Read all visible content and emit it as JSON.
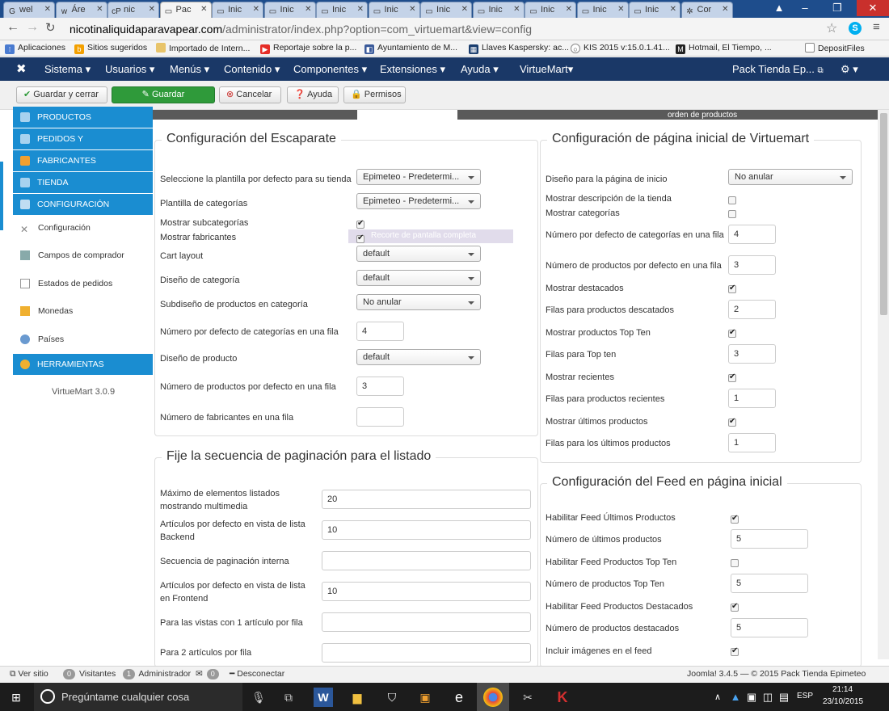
{
  "browser": {
    "tabs": [
      {
        "title": "wel",
        "icon": "G"
      },
      {
        "title": "Áre",
        "icon": "w"
      },
      {
        "title": "nic",
        "icon": "cP"
      },
      {
        "title": "Pac",
        "icon": "▭",
        "active": true
      },
      {
        "title": "Inic",
        "icon": "▭"
      },
      {
        "title": "Inic",
        "icon": "▭"
      },
      {
        "title": "Inic",
        "icon": "▭"
      },
      {
        "title": "Inic",
        "icon": "▭"
      },
      {
        "title": "Inic",
        "icon": "▭"
      },
      {
        "title": "Inic",
        "icon": "▭"
      },
      {
        "title": "Inic",
        "icon": "▭"
      },
      {
        "title": "Inic",
        "icon": "▭"
      },
      {
        "title": "Inic",
        "icon": "▭"
      },
      {
        "title": "Cor",
        "icon": "✲"
      }
    ],
    "url_host": "nicotinaliquidaparavapear.com",
    "url_path": "/administrator/index.php?option=com_virtuemart&view=config",
    "bookmarks": [
      "Aplicaciones",
      "Sitios sugeridos",
      "Importado de Intern...",
      "Reportaje sobre la p...",
      "Ayuntamiento de M...",
      "Llaves Kaspersky: ac...",
      "KIS 2015 v:15.0.1.41...",
      "Hotmail, El Tiempo, ...",
      "DepositFiles"
    ]
  },
  "nav": {
    "menus": [
      "Sistema",
      "Usuarios",
      "Menús",
      "Contenido",
      "Componentes",
      "Extensiones",
      "Ayuda",
      "VirtueMart"
    ],
    "site_name": "Pack Tienda Ep..."
  },
  "toolbar": {
    "save_close": "Guardar y cerrar",
    "save": "Guardar",
    "cancel": "Cancelar",
    "help": "Ayuda",
    "permissions": "Permisos"
  },
  "sidebar": {
    "heads": [
      "PRODUCTOS",
      "PEDIDOS Y",
      "FABRICANTES",
      "TIENDA",
      "CONFIGURACIÓN"
    ],
    "items": [
      "Configuración",
      "Campos de comprador",
      "Estados de pedidos",
      "Monedas",
      "Países"
    ],
    "tools": "HERRAMIENTAS",
    "version": "VirtueMart 3.0.9"
  },
  "top_tab_label": "orden de productos",
  "escaparate": {
    "title": "Configuración del Escaparate",
    "tooltip": "Recorte de pantalla completa",
    "rows": [
      {
        "label": "Seleccione la plantilla por defecto para su tienda",
        "value": "Epimeteo - Predetermi..."
      },
      {
        "label": "Plantilla de categorías",
        "value": "Epimeteo - Predetermi..."
      },
      {
        "label": "Mostrar subcategorías",
        "checked": true
      },
      {
        "label": "Mostrar fabricantes",
        "checked": true
      },
      {
        "label": "Cart layout",
        "value": "default"
      },
      {
        "label": "Diseño de categoría",
        "value": "default"
      },
      {
        "label": "Subdiseño de productos en categoría",
        "value": "No anular"
      },
      {
        "label": "Número por defecto de categorías en una fila",
        "value": "4"
      },
      {
        "label": "Diseño de producto",
        "value": "default"
      },
      {
        "label": "Número de productos por defecto en una fila",
        "value": "3"
      },
      {
        "label": "Número de fabricantes en una fila",
        "value": ""
      }
    ]
  },
  "paginacion": {
    "title": "Fije la secuencia de paginación para el listado",
    "rows": [
      {
        "label1": "Máximo de elementos listados",
        "label2": "mostrando multimedia",
        "value": "20"
      },
      {
        "label1": "Artículos por defecto en vista de lista",
        "label2": "Backend",
        "value": "10"
      },
      {
        "label1": "Secuencia de paginación interna",
        "label2": "",
        "value": ""
      },
      {
        "label1": "Artículos por defecto en vista de lista",
        "label2": "en Frontend",
        "value": "10"
      },
      {
        "label1": "Para las vistas con 1 artículo por fila",
        "label2": "",
        "value": ""
      },
      {
        "label1": "Para 2 artículos por fila",
        "label2": "",
        "value": ""
      }
    ]
  },
  "inicio": {
    "title": "Configuración de página inicial de Virtuemart",
    "rows": [
      {
        "label": "Diseño para la página de inicio",
        "value": "No anular"
      },
      {
        "label": "Mostrar descripción de la tienda",
        "checked": false
      },
      {
        "label": "Mostrar categorías",
        "checked": false
      },
      {
        "label": "Número por defecto de categorías en una fila",
        "value": "4"
      },
      {
        "label": "Número de productos por defecto en una fila",
        "value": "3"
      },
      {
        "label": "Mostrar destacados",
        "checked": true
      },
      {
        "label": "Filas para productos descatados",
        "value": "2"
      },
      {
        "label": "Mostrar productos Top Ten",
        "checked": true
      },
      {
        "label": "Filas para Top ten",
        "value": "3"
      },
      {
        "label": "Mostrar recientes",
        "checked": true
      },
      {
        "label": "Filas para productos recientes",
        "value": "1"
      },
      {
        "label": "Mostrar últimos productos",
        "checked": true
      },
      {
        "label": "Filas para los últimos productos",
        "value": "1"
      }
    ]
  },
  "feed": {
    "title": "Configuración del Feed en página inicial",
    "rows": [
      {
        "label": "Habilitar Feed Últimos Productos",
        "checked": true
      },
      {
        "label": "Número de últimos productos",
        "value": "5"
      },
      {
        "label": "Habilitar Feed Productos Top Ten",
        "checked": false
      },
      {
        "label": "Número de productos Top Ten",
        "value": "5"
      },
      {
        "label": "Habilitar Feed Productos Destacados",
        "checked": true
      },
      {
        "label": "Número de productos destacados",
        "value": "5"
      },
      {
        "label": "Incluir imágenes en el feed",
        "checked": true
      }
    ]
  },
  "status": {
    "view_site": "Ver sitio",
    "visitors_count": "0",
    "visitors": "Visitantes",
    "admin_count": "1",
    "admin": "Administrador",
    "msg_count": "0",
    "logout": "Desconectar",
    "version": "Joomla! 3.4.5 — © 2015 Pack Tienda Epimeteo"
  },
  "taskbar": {
    "search_placeholder": "Pregúntame cualquier cosa",
    "lang": "ESP",
    "time": "21:14",
    "date": "23/10/2015"
  }
}
